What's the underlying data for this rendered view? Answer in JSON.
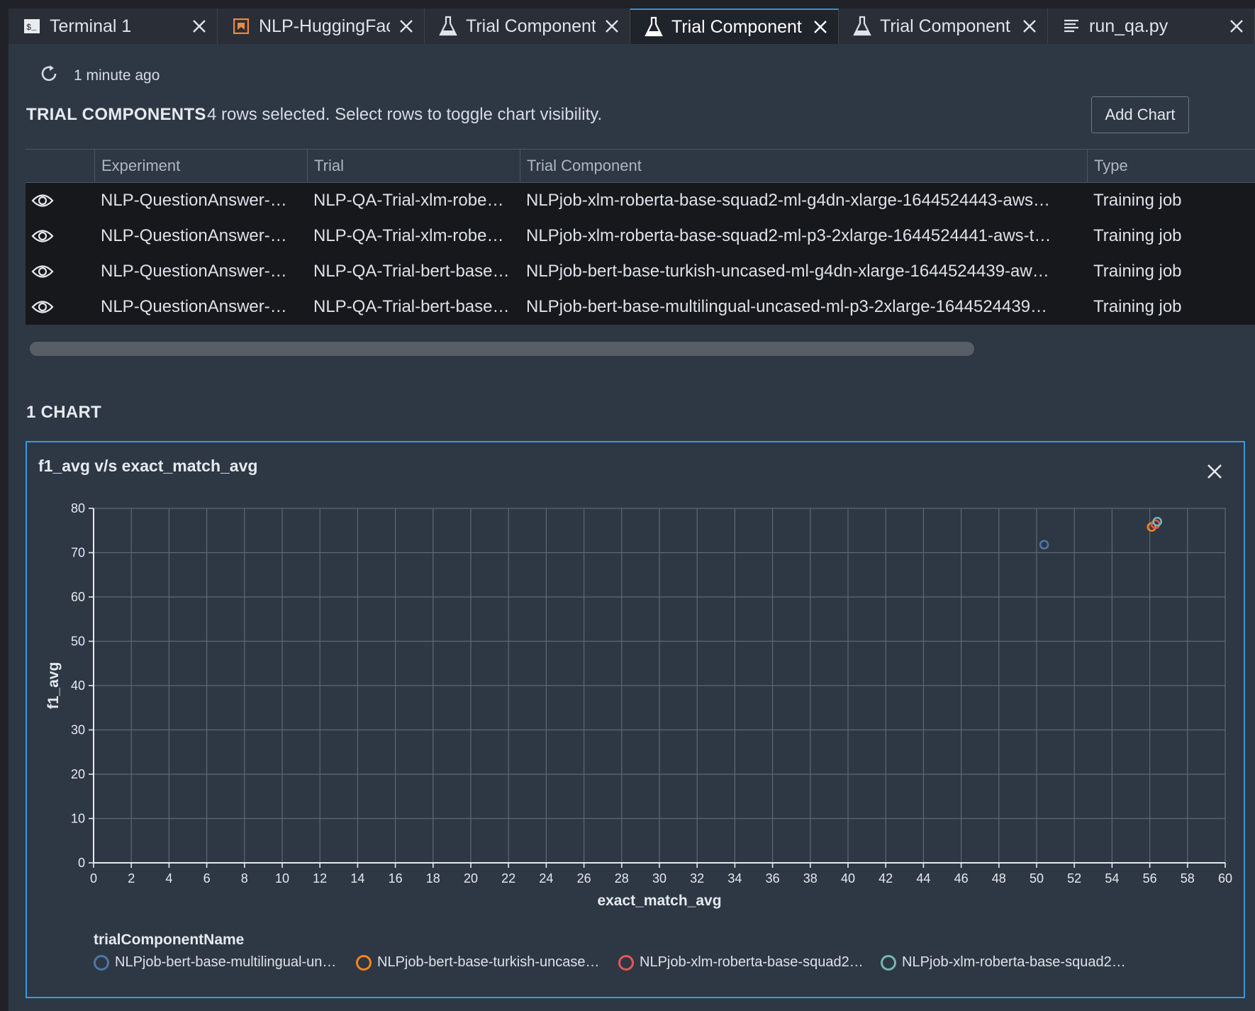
{
  "tabs": [
    {
      "label": "Terminal 1",
      "icon": "terminal-icon",
      "closable": true
    },
    {
      "label": "NLP-HuggingFac",
      "icon": "notebook-icon",
      "closable": true
    },
    {
      "label": "Trial Component",
      "icon": "flask-icon",
      "closable": true
    },
    {
      "label": "Trial Component",
      "icon": "flask-icon",
      "closable": true,
      "active": true
    },
    {
      "label": "Trial Component",
      "icon": "flask-icon",
      "closable": true
    },
    {
      "label": "run_qa.py",
      "icon": "text-file-icon",
      "closable": true
    }
  ],
  "refresh": {
    "label": "1 minute ago"
  },
  "trial_components": {
    "title": "TRIAL COMPONENTS",
    "selection_text": "4 rows selected. Select rows to toggle chart visibility.",
    "add_chart_label": "Add Chart",
    "columns": [
      "Experiment",
      "Trial",
      "Trial Component",
      "Type"
    ],
    "rows": [
      {
        "experiment": "NLP-QuestionAnswer-…",
        "trial": "NLP-QA-Trial-xlm-robe…",
        "component": "NLPjob-xlm-roberta-base-squad2-ml-g4dn-xlarge-1644524443-aws…",
        "type": "Training job"
      },
      {
        "experiment": "NLP-QuestionAnswer-…",
        "trial": "NLP-QA-Trial-xlm-robe…",
        "component": "NLPjob-xlm-roberta-base-squad2-ml-p3-2xlarge-1644524441-aws-t…",
        "type": "Training job"
      },
      {
        "experiment": "NLP-QuestionAnswer-…",
        "trial": "NLP-QA-Trial-bert-base…",
        "component": "NLPjob-bert-base-turkish-uncased-ml-g4dn-xlarge-1644524439-aw…",
        "type": "Training job"
      },
      {
        "experiment": "NLP-QuestionAnswer-…",
        "trial": "NLP-QA-Trial-bert-base…",
        "component": "NLPjob-bert-base-multilingual-uncased-ml-p3-2xlarge-1644524439…",
        "type": "Training job"
      }
    ]
  },
  "charts_section": {
    "title": "1 CHART"
  },
  "colors": {
    "accent": "#3a9ad9",
    "series_blue": "#4c78a8",
    "series_orange": "#f58518",
    "series_red": "#e45756",
    "series_teal": "#72b7b2"
  },
  "chart_data": {
    "type": "scatter",
    "title": "f1_avg v/s exact_match_avg",
    "xlabel": "exact_match_avg",
    "ylabel": "f1_avg",
    "xlim": [
      0,
      60
    ],
    "ylim": [
      0,
      80
    ],
    "x_ticks": [
      0,
      2,
      4,
      6,
      8,
      10,
      12,
      14,
      16,
      18,
      20,
      22,
      24,
      26,
      28,
      30,
      32,
      34,
      36,
      38,
      40,
      42,
      44,
      46,
      48,
      50,
      52,
      54,
      56,
      58,
      60
    ],
    "y_ticks": [
      0,
      10,
      20,
      30,
      40,
      50,
      60,
      70,
      80
    ],
    "grid": true,
    "legend_title": "trialComponentName",
    "legend_position": "bottom",
    "series": [
      {
        "name": "NLPjob-bert-base-multilingual-un…",
        "color": "#4c78a8",
        "points": [
          {
            "x": 50.4,
            "y": 71.8
          }
        ]
      },
      {
        "name": "NLPjob-bert-base-turkish-uncase…",
        "color": "#f58518",
        "points": [
          {
            "x": 56.1,
            "y": 75.8
          }
        ]
      },
      {
        "name": "NLPjob-xlm-roberta-base-squad2…",
        "color": "#e45756",
        "points": [
          {
            "x": 56.3,
            "y": 76.4
          }
        ]
      },
      {
        "name": "NLPjob-xlm-roberta-base-squad2…",
        "color": "#72b7b2",
        "points": [
          {
            "x": 56.4,
            "y": 77.0
          }
        ]
      }
    ]
  }
}
